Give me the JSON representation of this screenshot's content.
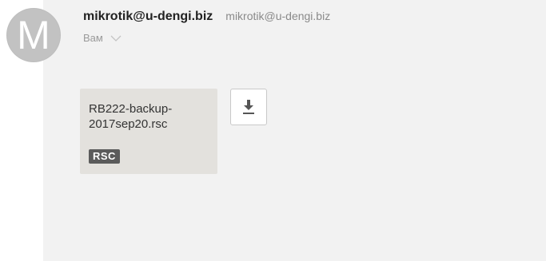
{
  "avatar": {
    "letter": "M"
  },
  "sender": {
    "name": "mikrotik@u-dengi.biz",
    "email": "mikrotik@u-dengi.biz"
  },
  "recipient": {
    "label": "Вам"
  },
  "attachment": {
    "filename": "RB222-backup-\n2017sep20.rsc",
    "extension": "RSC"
  },
  "icons": {
    "download": "download-icon",
    "chevron": "chevron-down-icon"
  },
  "colors": {
    "content_bg": "#f2f2f2",
    "card_bg": "#e3e1dd",
    "badge_bg": "#5b5b5b",
    "avatar_bg": "#c2c2c2"
  }
}
